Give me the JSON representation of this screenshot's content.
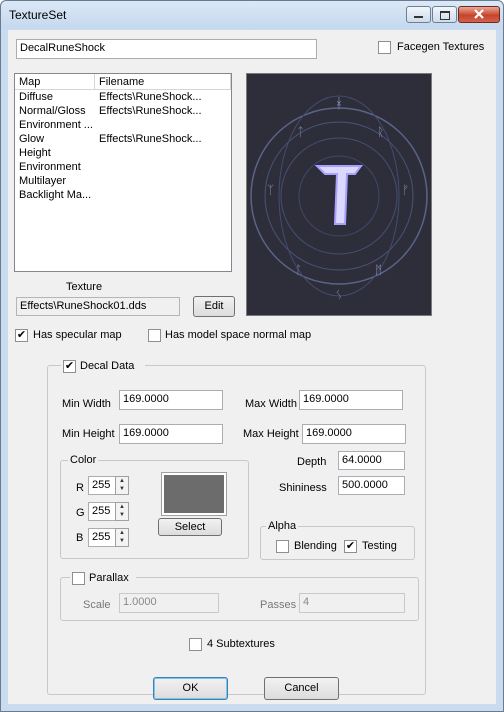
{
  "window": {
    "title": "TextureSet"
  },
  "name_field": {
    "value": "DecalRuneShock"
  },
  "facegen": {
    "label": "Facegen Textures",
    "checked": false
  },
  "map_list": {
    "headers": [
      "Map",
      "Filename"
    ],
    "rows": [
      {
        "map": "Diffuse",
        "file": "Effects\\RuneShock..."
      },
      {
        "map": "Normal/Gloss",
        "file": "Effects\\RuneShock..."
      },
      {
        "map": "Environment ...",
        "file": ""
      },
      {
        "map": "Glow",
        "file": "Effects\\RuneShock..."
      },
      {
        "map": "Height",
        "file": ""
      },
      {
        "map": "Environment",
        "file": ""
      },
      {
        "map": "Multilayer",
        "file": ""
      },
      {
        "map": "Backlight Ma...",
        "file": ""
      }
    ]
  },
  "texture": {
    "label": "Texture",
    "value": "Effects\\RuneShock01.dds",
    "edit_label": "Edit"
  },
  "specular": {
    "label": "Has specular map",
    "checked": true
  },
  "model_space": {
    "label": "Has model space normal map",
    "checked": false
  },
  "decal": {
    "label": "Decal Data",
    "checked": true,
    "min_width": {
      "label": "Min Width",
      "value": "169.0000"
    },
    "max_width": {
      "label": "Max Width",
      "value": "169.0000"
    },
    "min_height": {
      "label": "Min Height",
      "value": "169.0000"
    },
    "max_height": {
      "label": "Max Height",
      "value": "169.0000"
    },
    "depth": {
      "label": "Depth",
      "value": "64.0000"
    },
    "shininess": {
      "label": "Shininess",
      "value": "500.0000"
    },
    "color": {
      "label": "Color",
      "r": {
        "label": "R",
        "value": "255"
      },
      "g": {
        "label": "G",
        "value": "255"
      },
      "b": {
        "label": "B",
        "value": "255"
      },
      "swatch": "#6c6c6c",
      "select_label": "Select"
    },
    "alpha": {
      "label": "Alpha",
      "blending": {
        "label": "Blending",
        "checked": false
      },
      "testing": {
        "label": "Testing",
        "checked": true
      }
    },
    "parallax": {
      "label": "Parallax",
      "checked": false,
      "scale": {
        "label": "Scale",
        "value": "1.0000"
      },
      "passes": {
        "label": "Passes",
        "value": "4"
      }
    },
    "subtextures": {
      "label": "4 Subtextures",
      "checked": false
    }
  },
  "buttons": {
    "ok": "OK",
    "cancel": "Cancel"
  }
}
